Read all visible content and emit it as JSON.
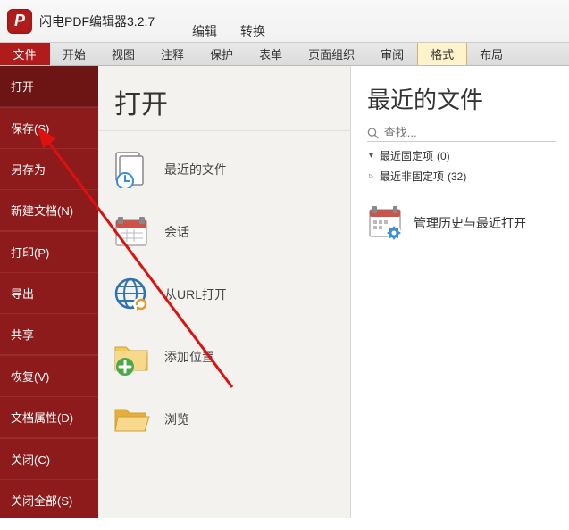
{
  "app": {
    "title": "闪电PDF编辑器3.2.7",
    "icon_letter": "P",
    "modes": {
      "edit": "编辑",
      "convert": "转换"
    }
  },
  "ribbon": {
    "file": "文件",
    "tabs": [
      "开始",
      "视图",
      "注释",
      "保护",
      "表单",
      "页面组织",
      "审阅",
      "格式",
      "布局"
    ]
  },
  "file_menu": {
    "open": "打开",
    "save": "保存(S)",
    "save_as": "另存为",
    "new_doc": "新建文档(N)",
    "print": "打印(P)",
    "export": "导出",
    "share": "共享",
    "restore": "恢复(V)",
    "doc_props": "文档属性(D)",
    "close": "关闭(C)",
    "close_all": "关闭全部(S)"
  },
  "open_panel": {
    "title": "打开",
    "recent_files": "最近的文件",
    "session": "会话",
    "from_url": "从URL打开",
    "add_location": "添加位置",
    "browse": "浏览"
  },
  "recent_panel": {
    "title": "最近的文件",
    "search_placeholder": "查找...",
    "pinned_label": "最近固定项 ",
    "pinned_count": "(0)",
    "unpinned_label": "最近非固定项 ",
    "unpinned_count": "(32)",
    "manage_label": "管理历史与最近打开"
  }
}
